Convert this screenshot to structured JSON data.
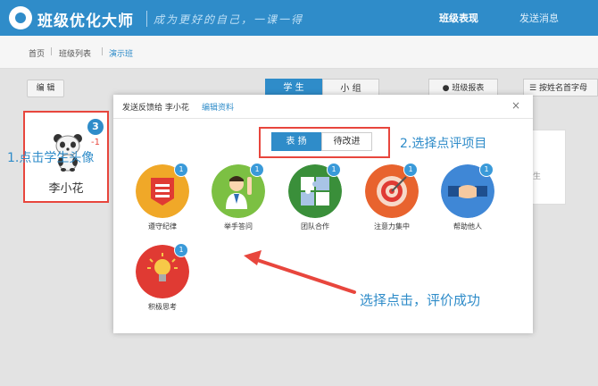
{
  "header": {
    "brand": "班级优化大师",
    "slogan": "成为更好的自己，一课一得",
    "nav": {
      "performance": "班级表现",
      "send": "发送消息"
    }
  },
  "breadcrumb": {
    "home": "首页",
    "separator": "|",
    "class_list": "班级列表",
    "current": "演示班"
  },
  "toolbar": {
    "edit": "编 辑",
    "tab_students": "学 生",
    "tab_groups": "小 组",
    "report": "班级报表",
    "sort": "按姓名首字母"
  },
  "student": {
    "score": "3",
    "delta": "-1",
    "name": "李小花"
  },
  "card_right_text": "生",
  "annotations": {
    "step1": "1.点击学生头像",
    "step2": "2.选择点评项目",
    "step3": "选择点击，评价成功"
  },
  "modal": {
    "title": "发送反馈给 李小花",
    "edit": "编辑资料",
    "close": "×",
    "toggle": {
      "praise": "表 扬",
      "improve": "待改进"
    },
    "items": [
      {
        "label": "遵守纪律",
        "badge": "1",
        "icon": "rules-icon"
      },
      {
        "label": "举手答问",
        "badge": "1",
        "icon": "raise-hand-icon"
      },
      {
        "label": "团队合作",
        "badge": "1",
        "icon": "puzzle-icon"
      },
      {
        "label": "注意力集中",
        "badge": "1",
        "icon": "target-icon"
      },
      {
        "label": "帮助他人",
        "badge": "1",
        "icon": "handshake-icon"
      },
      {
        "label": "积极思考",
        "badge": "1",
        "icon": "lightbulb-icon"
      }
    ]
  },
  "colors": {
    "header": "#2f8cc9",
    "highlight_red": "#e8463d",
    "annotation_blue": "#2f8cc9",
    "rules": "#f0a828",
    "raise_hand": "#7cc043",
    "teamwork": "#3a8f3a",
    "attention": "#e8632e",
    "help": "#3f87d6",
    "thinking": "#e03a33"
  }
}
